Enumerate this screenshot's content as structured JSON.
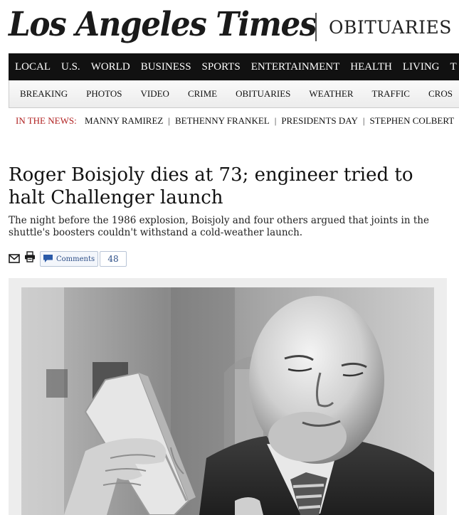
{
  "masthead": {
    "logo_text": "Los Angeles Times",
    "section": "OBITUARIES"
  },
  "main_nav": [
    "LOCAL",
    "U.S.",
    "WORLD",
    "BUSINESS",
    "SPORTS",
    "ENTERTAINMENT",
    "HEALTH",
    "LIVING",
    "T"
  ],
  "sub_nav": [
    "BREAKING",
    "PHOTOS",
    "VIDEO",
    "CRIME",
    "OBITUARIES",
    "WEATHER",
    "TRAFFIC",
    "CROS"
  ],
  "in_the_news": {
    "label": "IN THE NEWS:",
    "items": [
      "MANNY RAMIREZ",
      "BETHENNY FRANKEL",
      "PRESIDENTS DAY",
      "STEPHEN COLBERT"
    ]
  },
  "article": {
    "headline": "Roger Boisjoly dies at 73; engineer tried to halt Challenger launch",
    "dek": "The night before the 1986 explosion, Boisjoly and four others argued that joints in the shuttle's boosters couldn't withstand a cold-weather launch.",
    "comments_label": "Comments",
    "comment_count": "48"
  },
  "icons": {
    "email": "mail-icon",
    "print": "printer-icon",
    "comment": "speech-bubble-icon"
  },
  "colors": {
    "nav_background": "#111111",
    "news_label": "#b02020",
    "link_blue": "#2b4d86"
  }
}
